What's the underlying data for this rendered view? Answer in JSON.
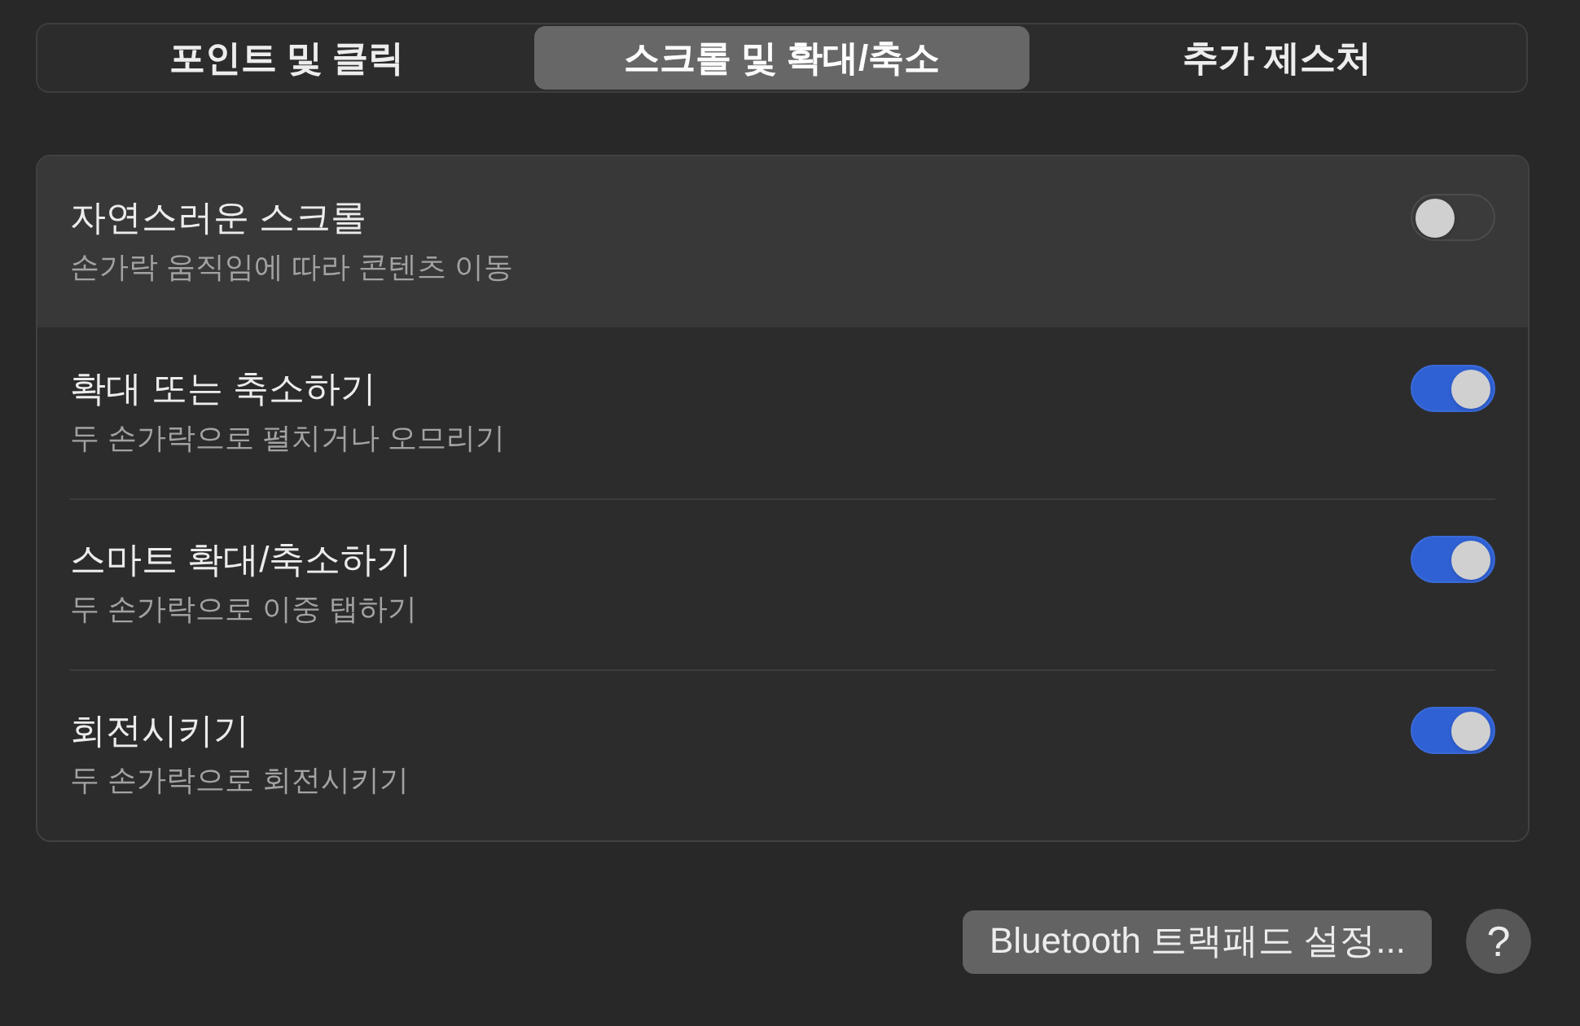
{
  "tabs": [
    {
      "label": "포인트 및 클릭",
      "selected": false
    },
    {
      "label": "스크롤 및 확대/축소",
      "selected": true
    },
    {
      "label": "추가 제스처",
      "selected": false
    }
  ],
  "settings": [
    {
      "title": "자연스러운 스크롤",
      "subtitle": "손가락 움직임에 따라 콘텐츠 이동",
      "on": false,
      "highlighted": true
    },
    {
      "title": "확대 또는 축소하기",
      "subtitle": "두 손가락으로 펼치거나 오므리기",
      "on": true,
      "highlighted": false
    },
    {
      "title": "스마트 확대/축소하기",
      "subtitle": "두 손가락으로 이중 탭하기",
      "on": true,
      "highlighted": false
    },
    {
      "title": "회전시키기",
      "subtitle": "두 손가락으로 회전시키기",
      "on": true,
      "highlighted": false
    }
  ],
  "bluetooth_button": {
    "label": "Bluetooth 트랙패드 설정..."
  },
  "help_button": {
    "label": "?"
  }
}
